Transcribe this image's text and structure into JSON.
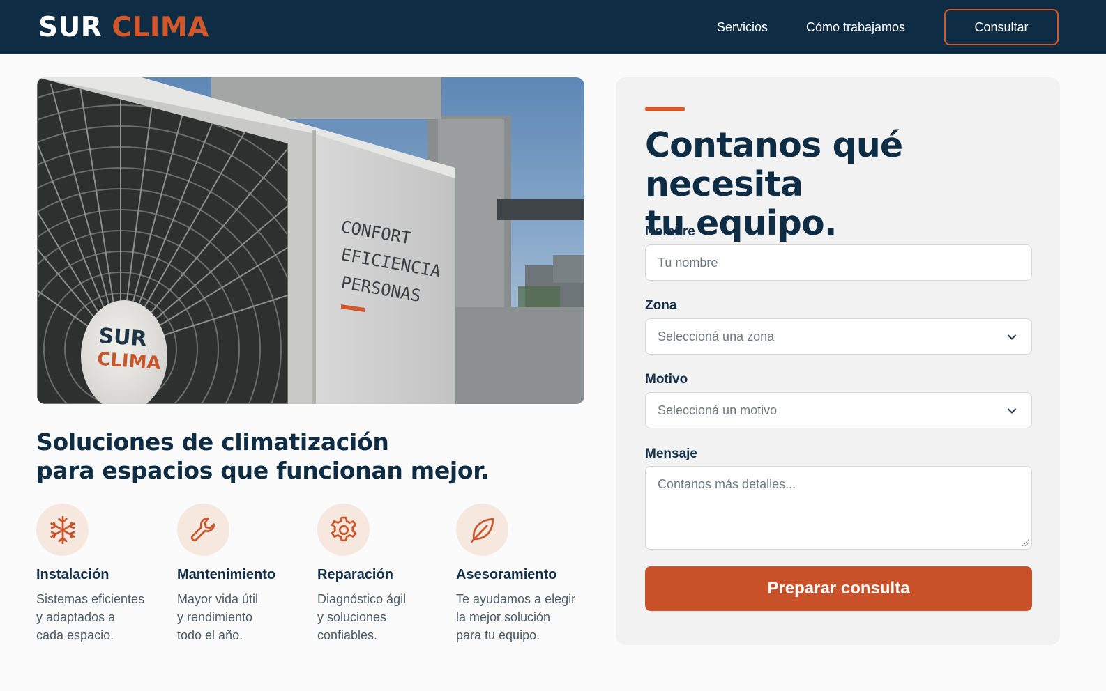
{
  "header": {
    "logo_part1": "SUR",
    "logo_part2": "CLIMA",
    "nav": [
      {
        "label": "Servicios"
      },
      {
        "label": "Cómo trabajamos"
      }
    ],
    "cta_label": "Consultar"
  },
  "hero": {
    "image_unit_text": [
      "CONFORT",
      "EFICIENCIA",
      "PERSONAS"
    ],
    "image_badge": [
      "SUR",
      "CLIMA"
    ],
    "title_line1": "Soluciones de climatización",
    "title_line2": "para espacios que funcionan mejor."
  },
  "features": [
    {
      "icon": "snowflake-icon",
      "title": "Instalación",
      "lines": [
        "Sistemas eficientes",
        "y adaptados a",
        "cada espacio."
      ]
    },
    {
      "icon": "wrench-icon",
      "title": "Mantenimiento",
      "lines": [
        "Mayor vida útil",
        "y rendimiento",
        "todo el año."
      ]
    },
    {
      "icon": "gear-icon",
      "title": "Reparación",
      "lines": [
        "Diagnóstico ágil",
        "y soluciones",
        "confiables."
      ]
    },
    {
      "icon": "leaf-icon",
      "title": "Asesoramiento",
      "lines": [
        "Te ayudamos a elegir",
        "la mejor solución",
        "para tu equipo."
      ]
    }
  ],
  "form": {
    "title_line1": "Contanos qué necesita",
    "title_line2": "tu equipo.",
    "name_label": "Nombre",
    "name_placeholder": "Tu nombre",
    "zone_label": "Zona",
    "zone_value": "Seleccioná una zona",
    "reason_label": "Motivo",
    "reason_value": "Seleccioná un motivo",
    "message_label": "Mensaje",
    "message_placeholder": "Contanos más detalles...",
    "submit_label": "Preparar consulta"
  },
  "colors": {
    "navy": "#0e2d45",
    "accent": "#d2572a",
    "card_bg": "#f2f2f2"
  }
}
